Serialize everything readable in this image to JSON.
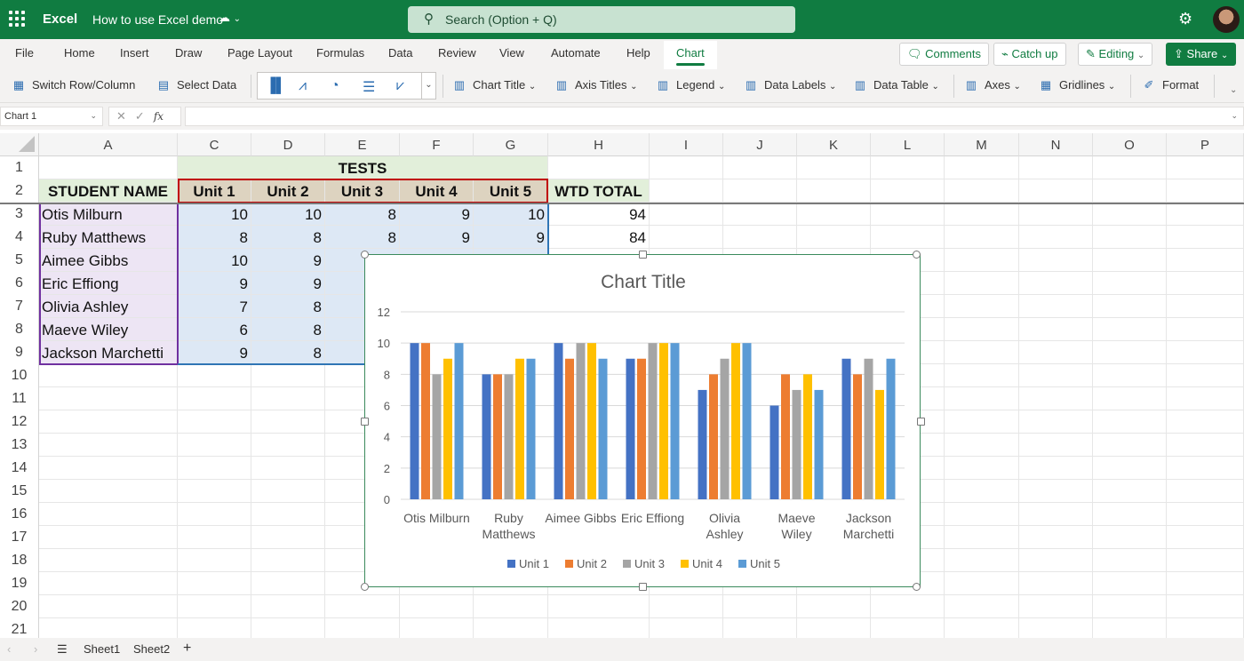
{
  "titlebar": {
    "app_name": "Excel",
    "doc_title": "How to use Excel demo",
    "search_placeholder": "Search (Option + Q)",
    "icons": {
      "waffle": "app-launcher-icon",
      "cloud": "cloud-saved-icon",
      "settings": "gear-icon",
      "avatar": "user-avatar"
    }
  },
  "menu_tabs": [
    "File",
    "Home",
    "Insert",
    "Draw",
    "Page Layout",
    "Formulas",
    "Data",
    "Review",
    "View",
    "Automate",
    "Help",
    "Chart"
  ],
  "active_tab": "Chart",
  "top_buttons": {
    "comments": "Comments",
    "catch_up": "Catch up",
    "editing": "Editing",
    "share": "Share"
  },
  "ribbon": {
    "switch_row_col": "Switch Row/Column",
    "select_data": "Select Data",
    "chart_types": [
      "column-chart-icon",
      "line-chart-icon",
      "pie-chart-icon",
      "bar-chart-icon",
      "area-chart-icon"
    ],
    "chart_title": "Chart Title",
    "axis_titles": "Axis Titles",
    "legend": "Legend",
    "data_labels": "Data Labels",
    "data_table": "Data Table",
    "axes": "Axes",
    "gridlines": "Gridlines",
    "format": "Format"
  },
  "formula_bar": {
    "name_box": "Chart 1",
    "formula": ""
  },
  "columns": [
    "A",
    "C",
    "D",
    "E",
    "F",
    "G",
    "H",
    "I",
    "J",
    "K",
    "L",
    "M",
    "N",
    "O",
    "P"
  ],
  "rows": [
    "1",
    "2",
    "3",
    "4",
    "5",
    "6",
    "7",
    "8",
    "9",
    "10",
    "11",
    "12",
    "13",
    "14",
    "15",
    "16",
    "17",
    "18",
    "19",
    "20",
    "21"
  ],
  "sheet": {
    "tests_header": "TESTS",
    "student_header": "STUDENT NAME",
    "unit_headers": [
      "Unit 1",
      "Unit 2",
      "Unit 3",
      "Unit 4",
      "Unit 5"
    ],
    "total_header": "WTD TOTAL",
    "students": [
      {
        "name": "Otis Milburn",
        "scores": [
          "10",
          "10",
          "8",
          "9",
          "10"
        ],
        "total": "94"
      },
      {
        "name": "Ruby Matthews",
        "scores": [
          "8",
          "8",
          "8",
          "9",
          "9"
        ],
        "total": "84"
      },
      {
        "name": "Aimee Gibbs",
        "scores": [
          "10",
          "9",
          "",
          "",
          ""
        ],
        "total": ""
      },
      {
        "name": "Eric Effiong",
        "scores": [
          "9",
          "9",
          "",
          "",
          ""
        ],
        "total": ""
      },
      {
        "name": "Olivia Ashley",
        "scores": [
          "7",
          "8",
          "",
          "",
          ""
        ],
        "total": ""
      },
      {
        "name": "Maeve Wiley",
        "scores": [
          "6",
          "8",
          "",
          "",
          ""
        ],
        "total": ""
      },
      {
        "name": "Jackson Marchetti",
        "scores": [
          "9",
          "8",
          "",
          "",
          ""
        ],
        "total": ""
      }
    ]
  },
  "sheet_tabs": [
    "Sheet1",
    "Sheet2"
  ],
  "chart_data": {
    "type": "bar",
    "title": "Chart Title",
    "categories": [
      "Otis Milburn",
      "Ruby Matthews",
      "Aimee Gibbs",
      "Eric Effiong",
      "Olivia Ashley",
      "Maeve Wiley",
      "Jackson Marchetti"
    ],
    "category_lines": [
      [
        "Otis Milburn"
      ],
      [
        "Ruby",
        "Matthews"
      ],
      [
        "Aimee Gibbs"
      ],
      [
        "Eric Effiong"
      ],
      [
        "Olivia",
        "Ashley"
      ],
      [
        "Maeve",
        "Wiley"
      ],
      [
        "Jackson",
        "Marchetti"
      ]
    ],
    "series": [
      {
        "name": "Unit 1",
        "color": "#4472c4",
        "values": [
          10,
          8,
          10,
          9,
          7,
          6,
          9
        ]
      },
      {
        "name": "Unit 2",
        "color": "#ed7d31",
        "values": [
          10,
          8,
          9,
          9,
          8,
          8,
          8
        ]
      },
      {
        "name": "Unit 3",
        "color": "#a5a5a5",
        "values": [
          8,
          8,
          10,
          10,
          9,
          7,
          9
        ]
      },
      {
        "name": "Unit 4",
        "color": "#ffc000",
        "values": [
          9,
          9,
          10,
          10,
          10,
          8,
          7
        ]
      },
      {
        "name": "Unit 5",
        "color": "#5b9bd5",
        "values": [
          10,
          9,
          9,
          10,
          10,
          7,
          9
        ]
      }
    ],
    "yticks": [
      0,
      2,
      4,
      6,
      8,
      10,
      12
    ],
    "ylim": [
      0,
      12
    ],
    "xlabel": "",
    "ylabel": "",
    "grid": true,
    "legend": "bottom"
  }
}
